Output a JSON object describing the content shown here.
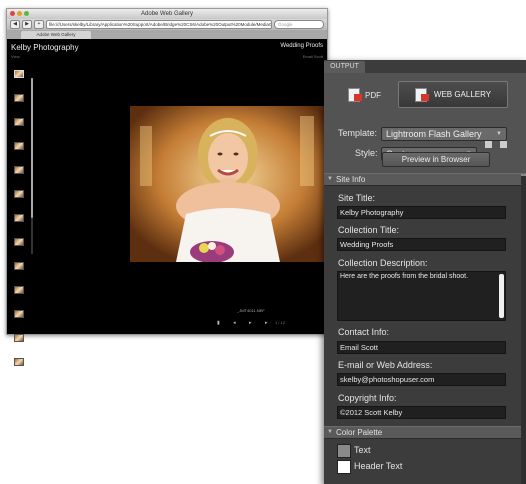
{
  "browser": {
    "window_title": "Adobe Web Gallery",
    "url": "file:///Users/skelby/Library/Application%20Support/Adobe/Bridge%20CS6/Adobe%20Output%20Module/MediaGallery/previewInBrowser1/index.html",
    "search_placeholder": "Google",
    "tab_title": "Adobe Web Gallery",
    "back": "◀",
    "forward": "▶",
    "add": "+"
  },
  "gallery": {
    "site_title": "Kelby Photography",
    "view_label": "View",
    "collection_title": "Wedding Proofs",
    "email_label": "Email Scott",
    "caption": "_JMT4011.NEF",
    "controls": "▮ ◂ ▸ ▸",
    "page": "1 / 12",
    "thumb_count": 13
  },
  "output": {
    "tab_label": "OUTPUT",
    "pdf_label": "PDF",
    "web_gallery_label": "WEB GALLERY",
    "template_label": "Template:",
    "template_value": "Lightroom Flash Gallery",
    "style_label": "Style:",
    "style_value": "Custom",
    "preview_button": "Preview in Browser"
  },
  "site_info": {
    "header": "Site Info",
    "site_title_label": "Site Title:",
    "site_title_value": "Kelby Photography",
    "collection_title_label": "Collection Title:",
    "collection_title_value": "Wedding Proofs",
    "collection_desc_label": "Collection Description:",
    "collection_desc_value": "Here are the proofs from the bridal shoot.",
    "contact_label": "Contact Info:",
    "contact_value": "Email Scott",
    "email_label": "E-mail or Web Address:",
    "email_value": "skelby@photoshopuser.com",
    "copyright_label": "Copyright Info:",
    "copyright_value": "©2012 Scott Kelby"
  },
  "color_palette": {
    "header": "Color Palette",
    "items": [
      {
        "label": "Text",
        "color": "#8a8a8a"
      },
      {
        "label": "Header Text",
        "color": "#ffffff"
      }
    ]
  },
  "colors": {
    "panel_bg": "#3c3c3c",
    "panel_top": "#535353",
    "field_bg": "#202020",
    "accent_red": "#d9362a"
  }
}
